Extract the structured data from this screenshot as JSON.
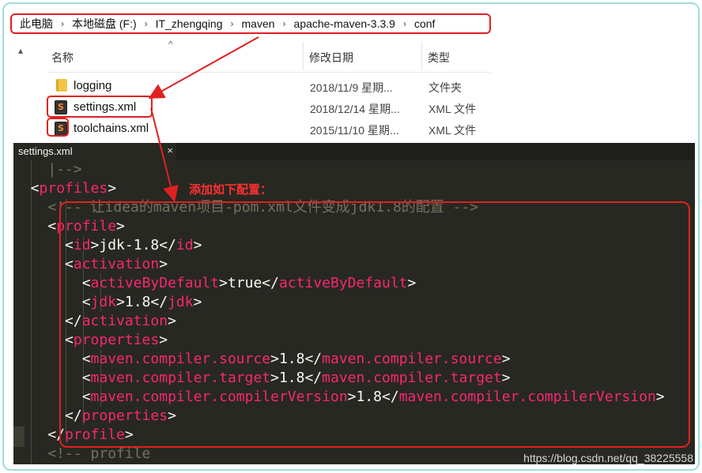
{
  "breadcrumb": [
    "此电脑",
    "本地磁盘 (F:)",
    "IT_zhengqing",
    "maven",
    "apache-maven-3.3.9",
    "conf"
  ],
  "explorer": {
    "columns": {
      "name": "名称",
      "date": "修改日期",
      "type": "类型"
    },
    "rows": [
      {
        "name": "logging",
        "date": "2018/11/9 星期...",
        "type": "文件夹",
        "icon": "folder-icon"
      },
      {
        "name": "settings.xml",
        "date": "2018/12/14 星期...",
        "type": "XML 文件",
        "icon": "sublime-file-icon"
      },
      {
        "name": "toolchains.xml",
        "date": "2015/11/10 星期...",
        "type": "XML 文件",
        "icon": "sublime-file-icon"
      }
    ]
  },
  "editor": {
    "tab_title": "settings.xml",
    "tab_close": "×",
    "note": "添加如下配置：",
    "lines": [
      {
        "parts": [
          {
            "t": "    |-->",
            "c": "cmt"
          }
        ]
      },
      {
        "parts": [
          {
            "t": "  <",
            "c": "txt"
          },
          {
            "t": "profiles",
            "c": "tag"
          },
          {
            "t": ">",
            "c": "txt"
          }
        ]
      },
      {
        "parts": [
          {
            "t": "    <!-- 让idea的maven项目-pom.xml文件变成jdk1.8的配置 -->",
            "c": "cmt"
          }
        ]
      },
      {
        "parts": [
          {
            "t": "    <",
            "c": "txt"
          },
          {
            "t": "profile",
            "c": "tag"
          },
          {
            "t": ">",
            "c": "txt"
          }
        ]
      },
      {
        "parts": [
          {
            "t": "      <",
            "c": "txt"
          },
          {
            "t": "id",
            "c": "tag"
          },
          {
            "t": ">jdk-1.8</",
            "c": "txt"
          },
          {
            "t": "id",
            "c": "tag"
          },
          {
            "t": ">",
            "c": "txt"
          }
        ]
      },
      {
        "parts": [
          {
            "t": "      <",
            "c": "txt"
          },
          {
            "t": "activation",
            "c": "tag"
          },
          {
            "t": ">",
            "c": "txt"
          }
        ]
      },
      {
        "parts": [
          {
            "t": "        <",
            "c": "txt"
          },
          {
            "t": "activeByDefault",
            "c": "tag"
          },
          {
            "t": ">true</",
            "c": "txt"
          },
          {
            "t": "activeByDefault",
            "c": "tag"
          },
          {
            "t": ">",
            "c": "txt"
          }
        ]
      },
      {
        "parts": [
          {
            "t": "        <",
            "c": "txt"
          },
          {
            "t": "jdk",
            "c": "tag"
          },
          {
            "t": ">1.8</",
            "c": "txt"
          },
          {
            "t": "jdk",
            "c": "tag"
          },
          {
            "t": ">",
            "c": "txt"
          }
        ]
      },
      {
        "parts": [
          {
            "t": "      </",
            "c": "txt"
          },
          {
            "t": "activation",
            "c": "tag"
          },
          {
            "t": ">",
            "c": "txt"
          }
        ]
      },
      {
        "parts": [
          {
            "t": "      <",
            "c": "txt"
          },
          {
            "t": "properties",
            "c": "tag"
          },
          {
            "t": ">",
            "c": "txt"
          }
        ]
      },
      {
        "parts": [
          {
            "t": "        <",
            "c": "txt"
          },
          {
            "t": "maven.compiler.source",
            "c": "tag"
          },
          {
            "t": ">1.8</",
            "c": "txt"
          },
          {
            "t": "maven.compiler.source",
            "c": "tag"
          },
          {
            "t": ">",
            "c": "txt"
          }
        ]
      },
      {
        "parts": [
          {
            "t": "        <",
            "c": "txt"
          },
          {
            "t": "maven.compiler.target",
            "c": "tag"
          },
          {
            "t": ">1.8</",
            "c": "txt"
          },
          {
            "t": "maven.compiler.target",
            "c": "tag"
          },
          {
            "t": ">",
            "c": "txt"
          }
        ]
      },
      {
        "parts": [
          {
            "t": "        <",
            "c": "txt"
          },
          {
            "t": "maven.compiler.compilerVersion",
            "c": "tag"
          },
          {
            "t": ">1.8</",
            "c": "txt"
          },
          {
            "t": "maven.compiler.compilerVersion",
            "c": "tag"
          },
          {
            "t": ">",
            "c": "txt"
          }
        ]
      },
      {
        "parts": [
          {
            "t": "      </",
            "c": "txt"
          },
          {
            "t": "properties",
            "c": "tag"
          },
          {
            "t": ">",
            "c": "txt"
          }
        ]
      },
      {
        "parts": [
          {
            "t": "    </",
            "c": "txt"
          },
          {
            "t": "profile",
            "c": "tag"
          },
          {
            "t": ">",
            "c": "txt"
          }
        ]
      },
      {
        "parts": [
          {
            "t": "    <!-- profile",
            "c": "cmt"
          }
        ]
      }
    ]
  },
  "watermark": "https://blog.csdn.net/qq_38225558",
  "colors": {
    "highlight": "#e02020",
    "tag": "#f92672",
    "comment": "#75715e",
    "editor_bg": "#272822"
  }
}
